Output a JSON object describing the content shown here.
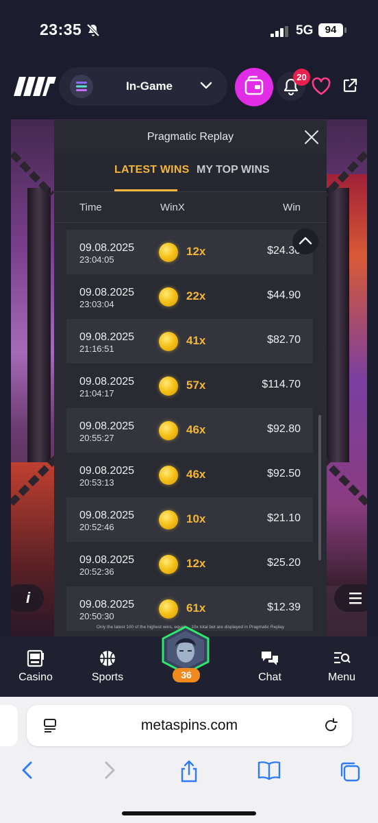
{
  "status_bar": {
    "time": "23:35",
    "network": "5G",
    "battery": "94"
  },
  "header": {
    "mode_select": "In-Game",
    "notification_count": "20"
  },
  "replay": {
    "title": "Pragmatic Replay",
    "tabs": {
      "latest": "LATEST WINS",
      "top": "MY TOP WINS"
    },
    "columns": {
      "time": "Time",
      "winx": "WinX",
      "win": "Win"
    },
    "rows": [
      {
        "date": "09.08.2025",
        "time": "23:04:05",
        "mult": "12x",
        "win": "$24.30"
      },
      {
        "date": "09.08.2025",
        "time": "23:03:04",
        "mult": "22x",
        "win": "$44.90"
      },
      {
        "date": "09.08.2025",
        "time": "21:16:51",
        "mult": "41x",
        "win": "$82.70"
      },
      {
        "date": "09.08.2025",
        "time": "21:04:17",
        "mult": "57x",
        "win": "$114.70"
      },
      {
        "date": "09.08.2025",
        "time": "20:55:27",
        "mult": "46x",
        "win": "$92.80"
      },
      {
        "date": "09.08.2025",
        "time": "20:53:13",
        "mult": "46x",
        "win": "$92.50"
      },
      {
        "date": "09.08.2025",
        "time": "20:52:46",
        "mult": "10x",
        "win": "$21.10"
      },
      {
        "date": "09.08.2025",
        "time": "20:52:36",
        "mult": "12x",
        "win": "$25.20"
      },
      {
        "date": "09.08.2025",
        "time": "20:50:30",
        "mult": "61x",
        "win": "$12.39"
      }
    ],
    "footnote": "Only the latest 100 of the highest wins, equal ... 10x total bet are displayed in Pragmatic Replay"
  },
  "game": {
    "info_label": "i"
  },
  "bottom_nav": {
    "items": [
      {
        "label": "Casino",
        "icon": "slot-machine-icon"
      },
      {
        "label": "Sports",
        "icon": "basketball-icon"
      },
      {
        "label": "Chat",
        "icon": "chat-icon"
      },
      {
        "label": "Menu",
        "icon": "menu-search-icon"
      }
    ],
    "avatar_level": "36"
  },
  "browser": {
    "url": "metaspins.com"
  },
  "colors": {
    "accent": "#f2b63a",
    "wallet": "#e22de6",
    "badge": "#e8204f",
    "level": "#f08a1f",
    "active_ring": "#2ee86b"
  }
}
